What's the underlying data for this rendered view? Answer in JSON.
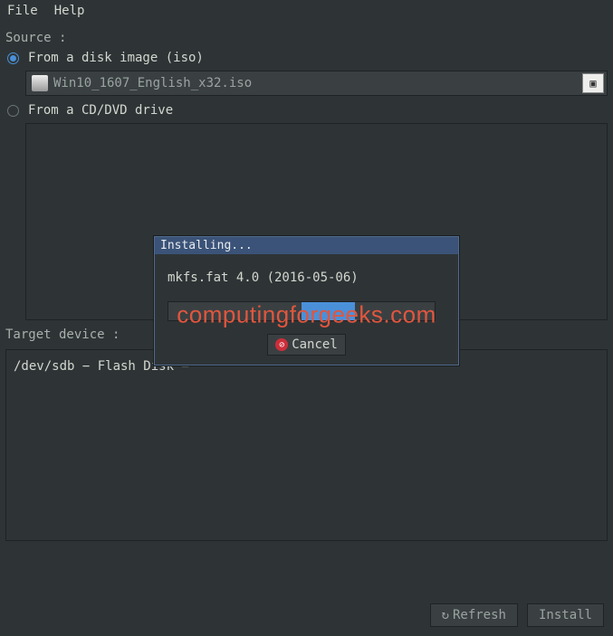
{
  "menu": {
    "file": "File",
    "help": "Help"
  },
  "source": {
    "label": "Source :",
    "from_image": "From a disk image (iso)",
    "from_drive": "From a CD/DVD drive",
    "filename": "Win10_1607_English_x32.iso"
  },
  "target": {
    "label": "Target device :",
    "device": "/dev/sdb − Flash Disk −"
  },
  "buttons": {
    "refresh": "Refresh",
    "install": "Install",
    "cancel": "Cancel"
  },
  "dialog": {
    "title": "Installing...",
    "message": "mkfs.fat 4.0 (2016-05-06)"
  },
  "watermark": "computingforgeeks.com"
}
